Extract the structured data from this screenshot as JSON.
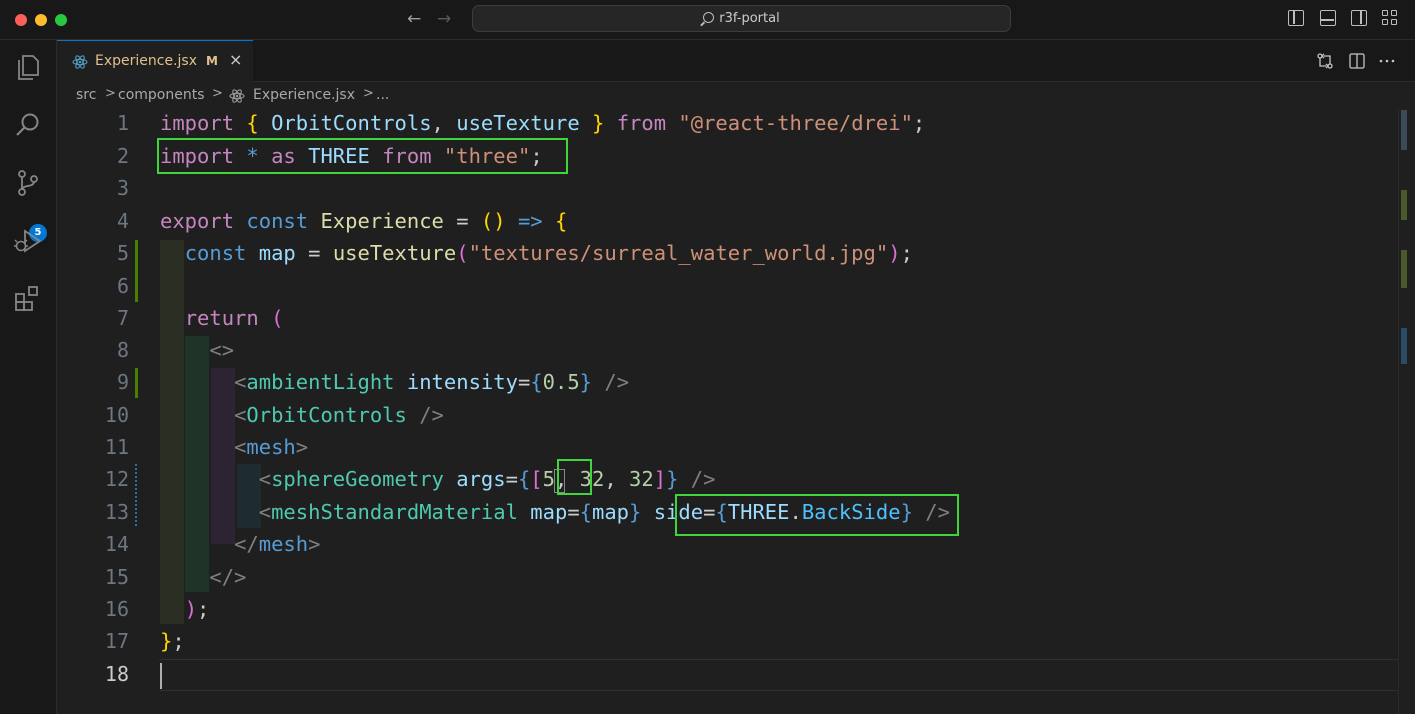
{
  "window": {
    "title": "r3f-portal",
    "nav_back": "←",
    "nav_forward": "→"
  },
  "activity_bar": {
    "items": [
      {
        "name": "explorer",
        "icon": "files-icon"
      },
      {
        "name": "search",
        "icon": "search-icon"
      },
      {
        "name": "source-control",
        "icon": "source-control-icon",
        "badge": "5"
      },
      {
        "name": "run-debug",
        "icon": "run-debug-icon"
      },
      {
        "name": "extensions",
        "icon": "extensions-icon"
      }
    ]
  },
  "tab": {
    "label": "Experience.jsx",
    "modified": "M",
    "close": "×",
    "icon": "react-icon"
  },
  "breadcrumb": {
    "items": [
      "src",
      "components",
      "Experience.jsx",
      "..."
    ],
    "separator": ">"
  },
  "editor": {
    "language": "jsx",
    "current_line": "18",
    "line_numbers": [
      "1",
      "2",
      "3",
      "4",
      "5",
      "6",
      "7",
      "8",
      "9",
      "10",
      "11",
      "12",
      "13",
      "14",
      "15",
      "16",
      "17",
      "18"
    ],
    "lines": [
      "import { OrbitControls, useTexture } from \"@react-three/drei\";",
      "import * as THREE from \"three\";",
      "",
      "export const Experience = () => {",
      "  const map = useTexture(\"textures/surreal_water_world.jpg\");",
      "",
      "  return (",
      "    <>",
      "      <ambientLight intensity={0.5} />",
      "      <OrbitControls />",
      "      <mesh>",
      "        <sphereGeometry args={[5, 32, 32]} />",
      "        <meshStandardMaterial map={map} side={THREE.BackSide} />",
      "      </mesh>",
      "    </>",
      "  );",
      "};",
      ""
    ],
    "highlights": [
      {
        "line": 2,
        "text": "import * as THREE from \"three\";"
      },
      {
        "line": 12,
        "text": "5,"
      },
      {
        "line": 13,
        "text": "side={THREE.BackSide}"
      }
    ]
  },
  "colors": {
    "background": "#1f1f1f",
    "chrome": "#181818",
    "accent": "#0078d4",
    "highlight_box": "#3fd53b",
    "gutter_added": "#487e02",
    "keyword": "#c586c0",
    "string": "#ce9178",
    "function": "#dcdcaa",
    "variable": "#9cdcfe",
    "component": "#4ec9b0"
  }
}
